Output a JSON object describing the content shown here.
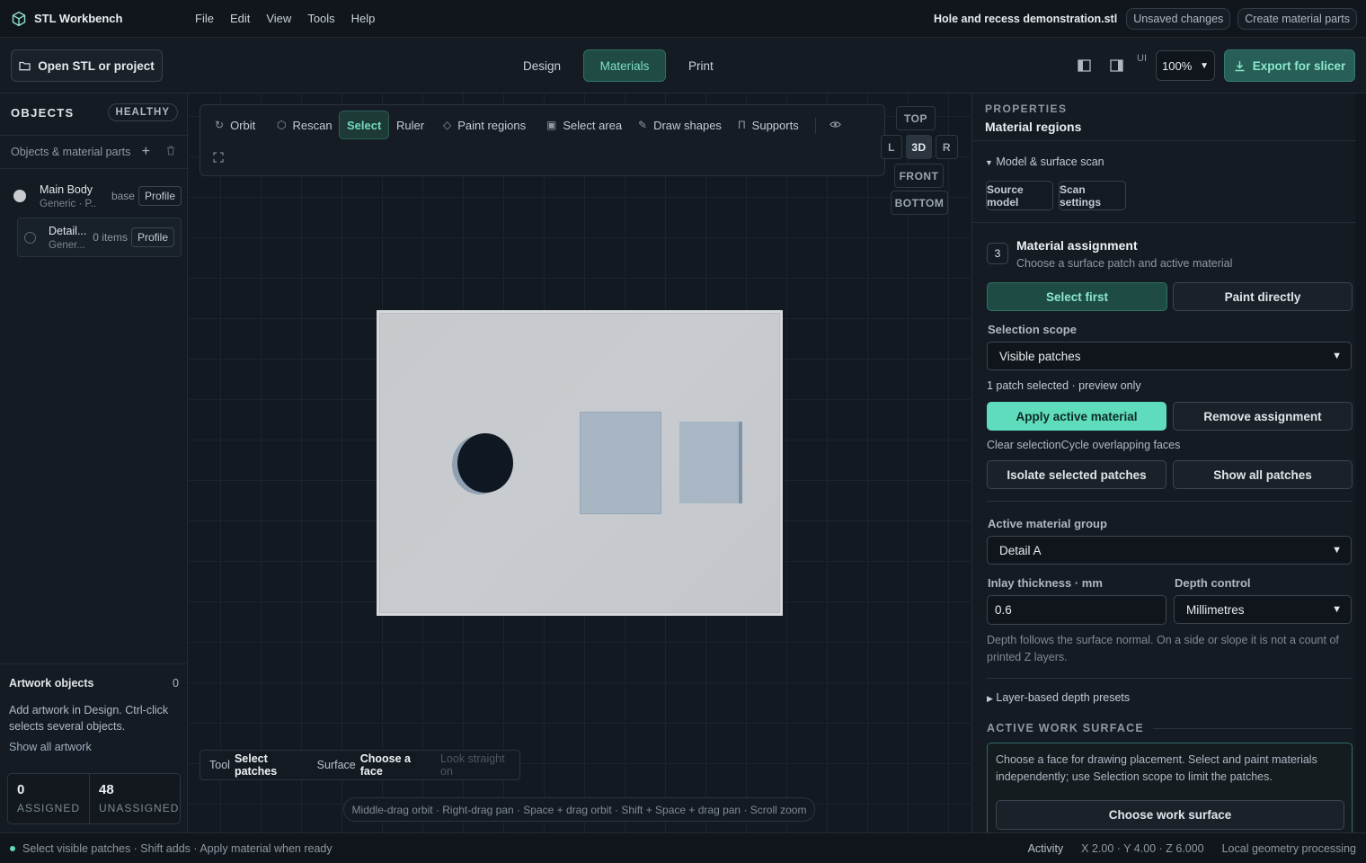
{
  "app": {
    "name": "STL Workbench"
  },
  "menu": [
    "File",
    "Edit",
    "View",
    "Tools",
    "Help"
  ],
  "header": {
    "filename": "Hole and recess demonstration.stl",
    "unsaved": "Unsaved changes",
    "create_parts": "Create material parts"
  },
  "toolbar": {
    "open_label": "Open STL or project",
    "tabs": [
      "Design",
      "Materials",
      "Print"
    ],
    "active_tab": "Materials",
    "ui_label": "UI",
    "zoom": "100%",
    "export_label": "Export for slicer"
  },
  "left": {
    "title": "OBJECTS",
    "health": "HEALTHY",
    "sub": "Objects & material parts",
    "objects": [
      {
        "name": "Main Body",
        "sub": "Generic · P...",
        "tag": "base",
        "profile": "Profile",
        "color": "#c8ccd0"
      },
      {
        "name": "Detail...",
        "sub": "Gener...",
        "tag": "0 items",
        "profile": "Profile",
        "color": "#5b6670"
      }
    ],
    "artwork_title": "Artwork objects",
    "artwork_count": "0",
    "artwork_desc": "Add artwork in Design. Ctrl-click selects several objects.",
    "artwork_link": "Show all artwork",
    "assigned_value": "0",
    "assigned_label": "ASSIGNED",
    "unassigned_value": "48",
    "unassigned_label": "UNASSIGNED"
  },
  "viewport": {
    "tools": [
      "Orbit",
      "Rescan",
      "Select",
      "Ruler",
      "Paint regions",
      "Select area",
      "Draw shapes",
      "Supports"
    ],
    "active_tool": "Select",
    "views": {
      "top": "TOP",
      "left": "L",
      "iso": "3D",
      "right": "R",
      "front": "FRONT",
      "bottom": "BOTTOM"
    },
    "status_tool_key": "Tool",
    "status_tool_val": "Select patches",
    "status_surface_key": "Surface",
    "status_surface_val": "Choose a face",
    "status_look": "Look straight on",
    "hint": "Middle-drag orbit · Right-drag pan · Space + drag orbit · Shift + Space + drag pan · Scroll zoom"
  },
  "right": {
    "kicker": "PROPERTIES",
    "title": "Material regions",
    "scan_section": "Model & surface scan",
    "source_model": "Source model",
    "scan_settings": "Scan settings",
    "step_number": "3",
    "step_title": "Material assignment",
    "step_sub": "Choose a surface patch and active material",
    "select_first": "Select first",
    "paint_directly": "Paint directly",
    "scope_label": "Selection scope",
    "scope_value": "Visible patches",
    "selected_info": "1 patch selected · preview only",
    "apply": "Apply active material",
    "remove": "Remove assignment",
    "clear_cycle": "Clear selectionCycle overlapping faces",
    "isolate": "Isolate selected patches",
    "show_all": "Show all patches",
    "group_label": "Active material group",
    "group_value": "Detail A",
    "thickness_label": "Inlay thickness · mm",
    "thickness_value": "0.6",
    "depth_label": "Depth control",
    "depth_value": "Millimetres",
    "depth_note": "Depth follows the surface normal. On a side or slope it is not a count of printed Z layers.",
    "presets": "Layer-based depth presets",
    "aws_title": "ACTIVE WORK SURFACE",
    "aws_text": "Choose a face for drawing placement. Select and paint materials independently; use Selection scope to limit the patches.",
    "aws_button": "Choose work surface"
  },
  "status": {
    "message": "Select visible patches · Shift adds · Apply material when ready",
    "activity": "Activity",
    "coords": "X 2.00 · Y 4.00 · Z 6.000",
    "processing": "Local geometry processing"
  },
  "colors": {
    "accent": "#5fdcbc",
    "background": "#141a21"
  }
}
